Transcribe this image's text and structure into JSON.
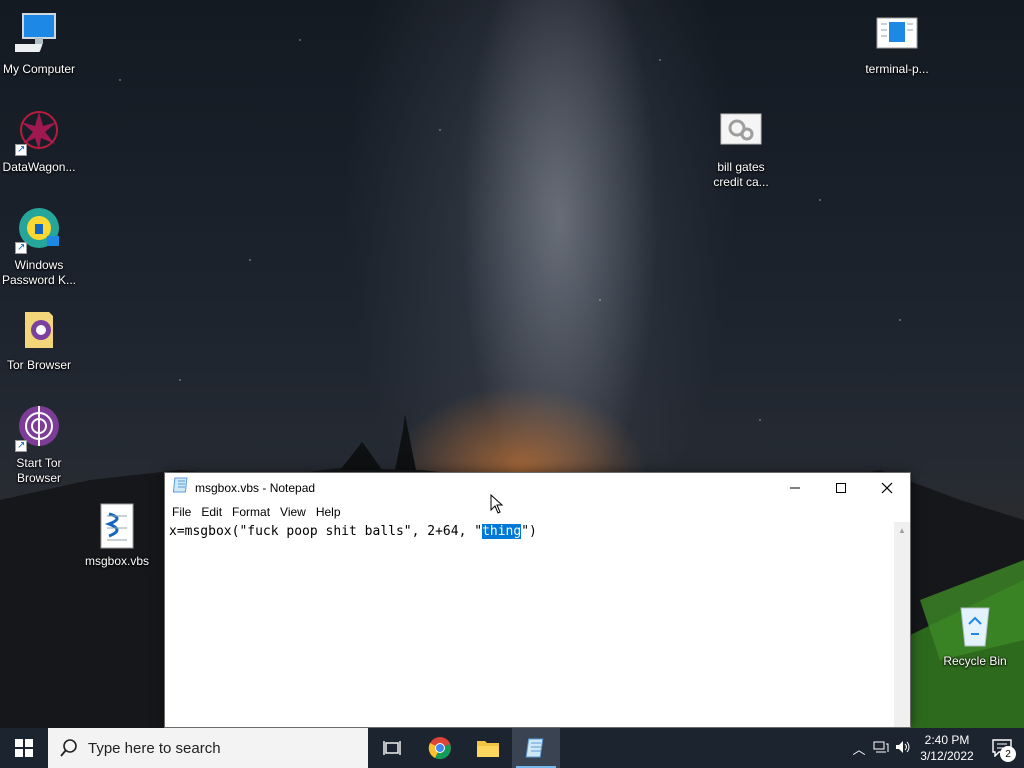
{
  "desktop": {
    "icons": [
      {
        "label": "My Computer"
      },
      {
        "label": "DataWagon..."
      },
      {
        "label_line1": "Windows",
        "label_line2": "Password K..."
      },
      {
        "label": "Tor Browser"
      },
      {
        "label_line1": "Start Tor",
        "label_line2": "Browser"
      },
      {
        "label": "msgbox.vbs"
      },
      {
        "label": "terminal-p..."
      },
      {
        "label_line1": "bill gates",
        "label_line2": "credit ca..."
      },
      {
        "label": "Recycle Bin"
      }
    ]
  },
  "notepad": {
    "title": "msgbox.vbs - Notepad",
    "menu": [
      "File",
      "Edit",
      "Format",
      "View",
      "Help"
    ],
    "content_before": "x=msgbox(\"fuck poop shit balls\", 2+64, \"",
    "content_selected": "thing",
    "content_after": "\")"
  },
  "taskbar": {
    "search_placeholder": "Type here to search",
    "time": "2:40 PM",
    "date": "3/12/2022",
    "notification_count": "2"
  },
  "colors": {
    "selection": "#0078d7",
    "taskbar": "#1c2430",
    "accent": "#76b9ed"
  }
}
